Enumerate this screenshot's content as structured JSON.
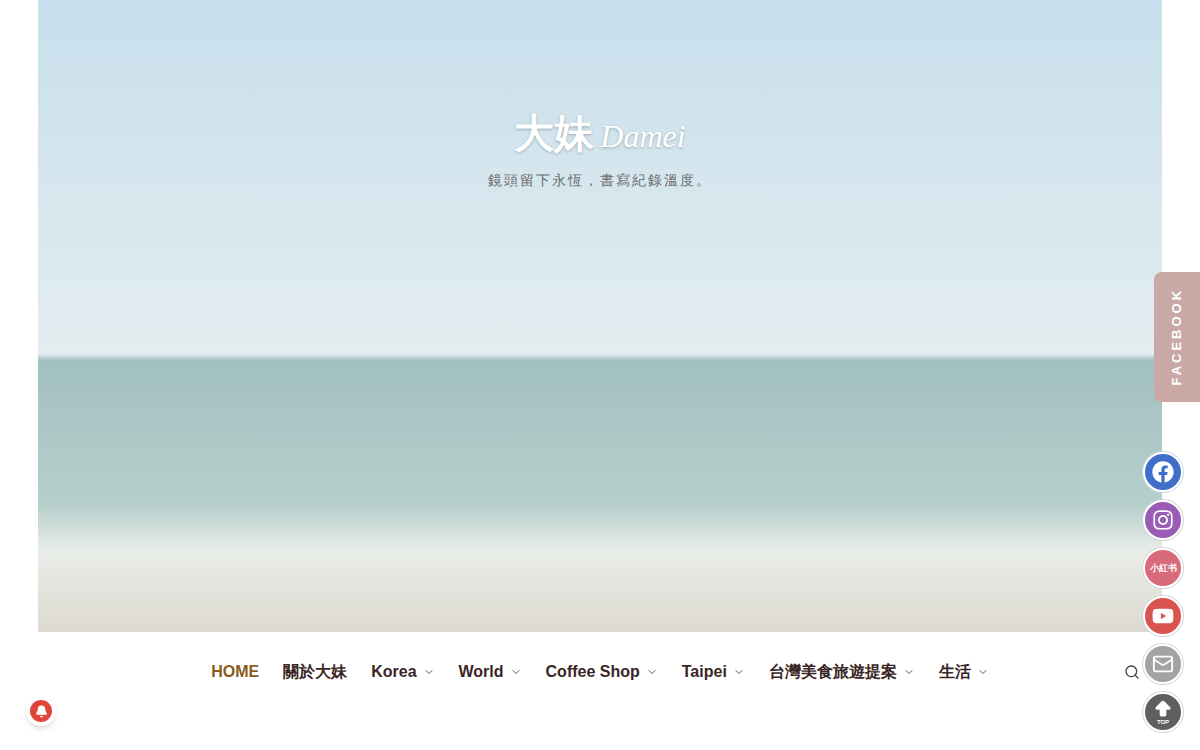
{
  "site": {
    "title": "大妹",
    "title_latin": "Damei",
    "tagline": "鏡頭留下永恆，書寫紀錄溫度。"
  },
  "nav": {
    "items": [
      {
        "label": "HOME",
        "selected": true,
        "has_submenu": false
      },
      {
        "label": "關於大妹",
        "selected": false,
        "has_submenu": false
      },
      {
        "label": "Korea",
        "selected": false,
        "has_submenu": true
      },
      {
        "label": "World",
        "selected": false,
        "has_submenu": true
      },
      {
        "label": "Coffee Shop",
        "selected": false,
        "has_submenu": true
      },
      {
        "label": "Taipei",
        "selected": false,
        "has_submenu": true
      },
      {
        "label": "台灣美食旅遊提案",
        "selected": false,
        "has_submenu": true
      },
      {
        "label": "生活",
        "selected": false,
        "has_submenu": true
      }
    ]
  },
  "facebook_tab": {
    "label": "FACEBOOK"
  },
  "social": [
    {
      "kind": "facebook",
      "label": "",
      "color": "#3f6fc9"
    },
    {
      "kind": "instagram",
      "label": "",
      "color": "#9a5cb4"
    },
    {
      "kind": "xiaohongshu",
      "label": "小紅书",
      "color": "#d86a7b"
    },
    {
      "kind": "youtube",
      "label": "",
      "color": "#d9534f"
    },
    {
      "kind": "email",
      "label": "",
      "color": "#a3a3a3"
    },
    {
      "kind": "top",
      "label": "TOP",
      "color": "#5f5f5f"
    }
  ]
}
